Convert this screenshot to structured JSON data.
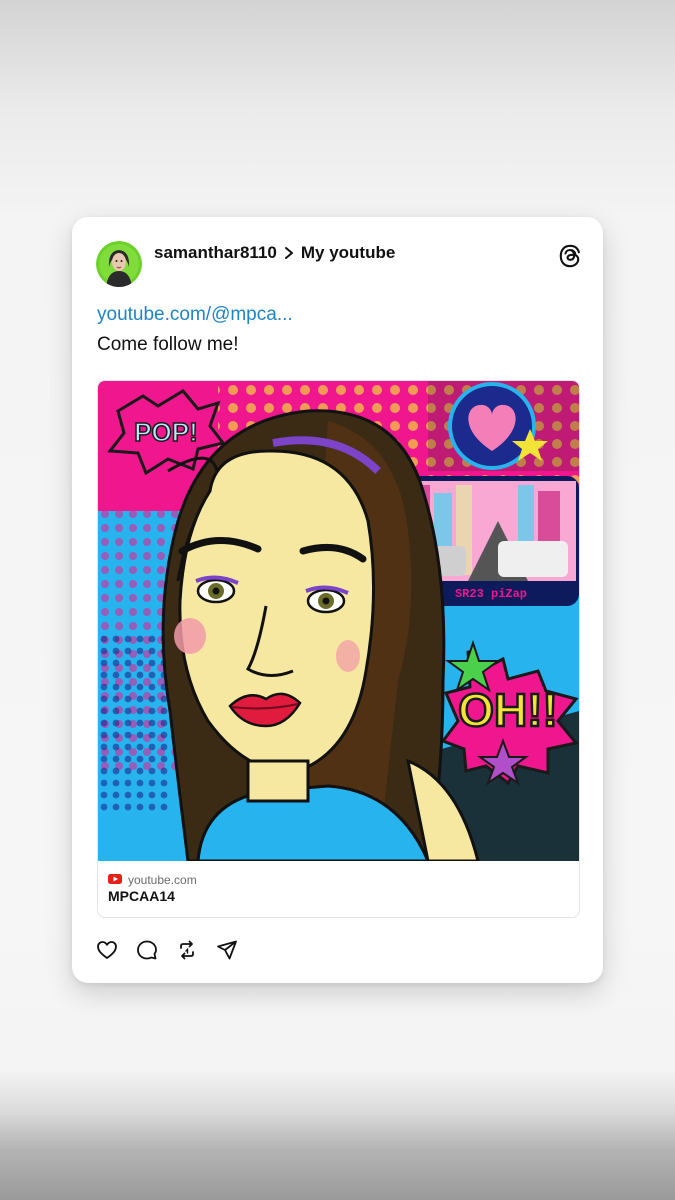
{
  "post": {
    "username": "samanthar8110",
    "topic": "My youtube",
    "link_text": "youtube.com/@mpca...",
    "body": "Come follow me!"
  },
  "media": {
    "artwork_text": {
      "pop_burst": "POP!",
      "oh_burst": "OH!!",
      "tag": "SR23 piZap"
    }
  },
  "link_preview": {
    "domain": "youtube.com",
    "title": "MPCAA14"
  },
  "icons": {
    "avatar": "avatar",
    "threads": "threads-icon",
    "chevron": "chevron-right-icon",
    "youtube": "youtube-icon",
    "actions": [
      "heart-icon",
      "comment-icon",
      "repost-icon",
      "share-icon"
    ]
  },
  "colors": {
    "link": "#1f84c4",
    "avatar_ring": "#6cd12b",
    "youtube_red": "#e62117",
    "art_magenta": "#f0168e",
    "art_cyan": "#27b4ee",
    "art_yellow": "#f3e337"
  }
}
